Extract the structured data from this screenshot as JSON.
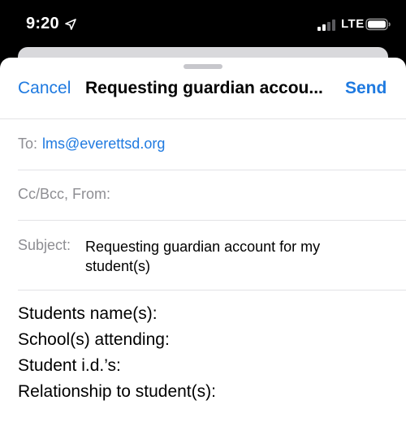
{
  "status_bar": {
    "time": "9:20",
    "network": "LTE",
    "icons": [
      "location-arrow-icon",
      "signal-bars-icon",
      "battery-icon"
    ]
  },
  "compose": {
    "nav": {
      "cancel_label": "Cancel",
      "title": "Requesting guardian accou...",
      "send_label": "Send"
    },
    "to": {
      "label": "To:",
      "value": "lms@everettsd.org"
    },
    "cc_bcc_from": {
      "label": "Cc/Bcc, From:"
    },
    "subject": {
      "label": "Subject:",
      "value": "Requesting guardian account for my student(s)"
    },
    "body": {
      "lines": [
        "Students name(s):",
        "School(s) attending:",
        "Student i.d.’s:",
        "Relationship to student(s):"
      ]
    }
  },
  "colors": {
    "accent": "#1f7ae0",
    "label_gray": "#8e8e93",
    "divider": "#e3e3e6",
    "status_bar_bg": "#000000"
  }
}
